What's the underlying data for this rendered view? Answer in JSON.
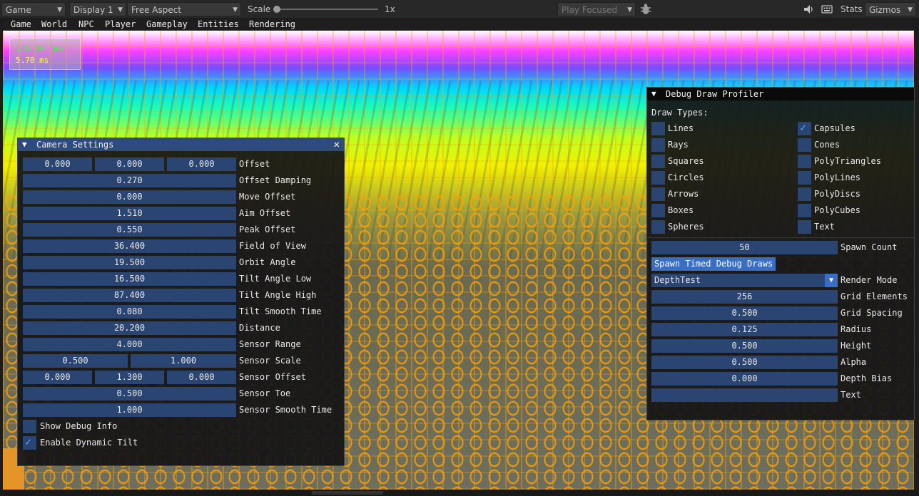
{
  "toolbar": {
    "game_tab": "Game",
    "display": "Display 1",
    "aspect": "Free Aspect",
    "scale_label": "Scale",
    "scale_value": "1x",
    "play_mode": "Play Focused",
    "stats": "Stats",
    "gizmos": "Gizmos"
  },
  "menu": [
    "Game",
    "World",
    "NPC",
    "Player",
    "Gameplay",
    "Entities",
    "Rendering"
  ],
  "fps": {
    "fps": "175.54 fps",
    "ms": "5.70 ms"
  },
  "camera_settings": {
    "title": "Camera Settings",
    "rows": [
      {
        "values": [
          "0.000",
          "0.000",
          "0.000"
        ],
        "label": "Offset"
      },
      {
        "values": [
          "0.270"
        ],
        "label": "Offset Damping"
      },
      {
        "values": [
          "0.000"
        ],
        "label": "Move Offset"
      },
      {
        "values": [
          "1.510"
        ],
        "label": "Aim Offset"
      },
      {
        "values": [
          "0.550"
        ],
        "label": "Peak Offset"
      },
      {
        "values": [
          "36.400"
        ],
        "label": "Field of View"
      },
      {
        "values": [
          "19.500"
        ],
        "label": "Orbit Angle"
      },
      {
        "values": [
          "16.500"
        ],
        "label": "Tilt Angle Low"
      },
      {
        "values": [
          "87.400"
        ],
        "label": "Tilt Angle High"
      },
      {
        "values": [
          "0.080"
        ],
        "label": "Tilt Smooth Time"
      },
      {
        "values": [
          "20.200"
        ],
        "label": "Distance"
      },
      {
        "values": [
          "4.000"
        ],
        "label": "Sensor Range"
      },
      {
        "values": [
          "0.500",
          "1.000"
        ],
        "label": "Sensor Scale"
      },
      {
        "values": [
          "0.000",
          "1.300",
          "0.000"
        ],
        "label": "Sensor Offset"
      },
      {
        "values": [
          "0.500"
        ],
        "label": "Sensor Toe"
      },
      {
        "values": [
          "1.000"
        ],
        "label": "Sensor Smooth Time"
      }
    ],
    "show_debug_info": {
      "label": "Show Debug Info",
      "checked": false
    },
    "enable_dynamic_tilt": {
      "label": "Enable Dynamic Tilt",
      "checked": true
    }
  },
  "profiler": {
    "title": "Debug Draw Profiler",
    "draw_types_label": "Draw Types:",
    "left_types": [
      {
        "label": "Lines",
        "checked": false
      },
      {
        "label": "Rays",
        "checked": false
      },
      {
        "label": "Squares",
        "checked": false
      },
      {
        "label": "Circles",
        "checked": false
      },
      {
        "label": "Arrows",
        "checked": false
      },
      {
        "label": "Boxes",
        "checked": false
      },
      {
        "label": "Spheres",
        "checked": false
      }
    ],
    "right_types": [
      {
        "label": "Capsules",
        "checked": true
      },
      {
        "label": "Cones",
        "checked": false
      },
      {
        "label": "PolyTriangles",
        "checked": false
      },
      {
        "label": "PolyLines",
        "checked": false
      },
      {
        "label": "PolyDiscs",
        "checked": false
      },
      {
        "label": "PolyCubes",
        "checked": false
      },
      {
        "label": "Text",
        "checked": false
      }
    ],
    "spawn_count": {
      "value": "50",
      "label": "Spawn Count"
    },
    "spawn_button": "Spawn Timed Debug Draws",
    "render_mode": {
      "value": "DepthTest",
      "label": "Render Mode"
    },
    "fields": [
      {
        "value": "256",
        "label": "Grid Elements"
      },
      {
        "value": "0.500",
        "label": "Grid Spacing"
      },
      {
        "value": "0.125",
        "label": "Radius"
      },
      {
        "value": "0.500",
        "label": "Height"
      },
      {
        "value": "0.500",
        "label": "Alpha"
      },
      {
        "value": "0.000",
        "label": "Depth Bias"
      },
      {
        "value": "",
        "label": "Text"
      }
    ]
  }
}
